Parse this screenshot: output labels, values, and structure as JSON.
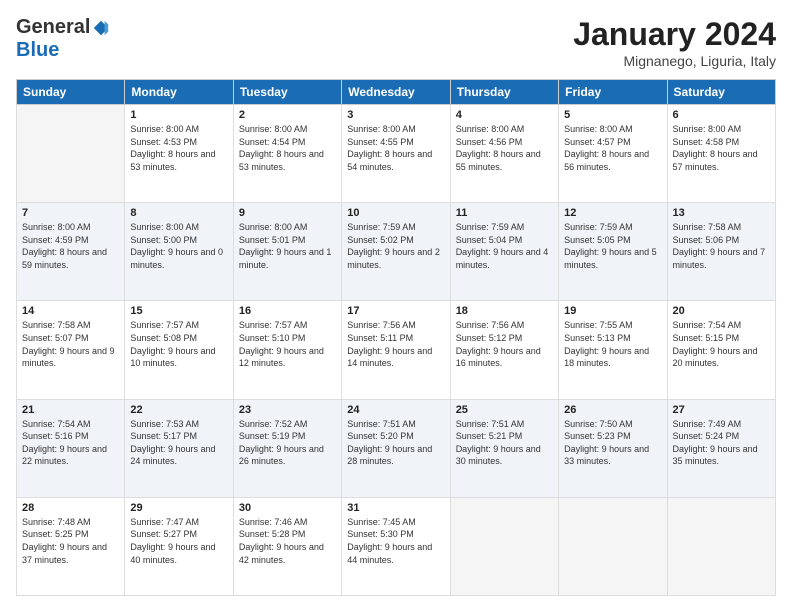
{
  "header": {
    "logo_general": "General",
    "logo_blue": "Blue",
    "month_title": "January 2024",
    "location": "Mignanego, Liguria, Italy"
  },
  "days_of_week": [
    "Sunday",
    "Monday",
    "Tuesday",
    "Wednesday",
    "Thursday",
    "Friday",
    "Saturday"
  ],
  "weeks": [
    [
      {
        "day": "",
        "sunrise": "",
        "sunset": "",
        "daylight": "",
        "empty": true
      },
      {
        "day": "1",
        "sunrise": "Sunrise: 8:00 AM",
        "sunset": "Sunset: 4:53 PM",
        "daylight": "Daylight: 8 hours and 53 minutes."
      },
      {
        "day": "2",
        "sunrise": "Sunrise: 8:00 AM",
        "sunset": "Sunset: 4:54 PM",
        "daylight": "Daylight: 8 hours and 53 minutes."
      },
      {
        "day": "3",
        "sunrise": "Sunrise: 8:00 AM",
        "sunset": "Sunset: 4:55 PM",
        "daylight": "Daylight: 8 hours and 54 minutes."
      },
      {
        "day": "4",
        "sunrise": "Sunrise: 8:00 AM",
        "sunset": "Sunset: 4:56 PM",
        "daylight": "Daylight: 8 hours and 55 minutes."
      },
      {
        "day": "5",
        "sunrise": "Sunrise: 8:00 AM",
        "sunset": "Sunset: 4:57 PM",
        "daylight": "Daylight: 8 hours and 56 minutes."
      },
      {
        "day": "6",
        "sunrise": "Sunrise: 8:00 AM",
        "sunset": "Sunset: 4:58 PM",
        "daylight": "Daylight: 8 hours and 57 minutes."
      }
    ],
    [
      {
        "day": "7",
        "sunrise": "Sunrise: 8:00 AM",
        "sunset": "Sunset: 4:59 PM",
        "daylight": "Daylight: 8 hours and 59 minutes."
      },
      {
        "day": "8",
        "sunrise": "Sunrise: 8:00 AM",
        "sunset": "Sunset: 5:00 PM",
        "daylight": "Daylight: 9 hours and 0 minutes."
      },
      {
        "day": "9",
        "sunrise": "Sunrise: 8:00 AM",
        "sunset": "Sunset: 5:01 PM",
        "daylight": "Daylight: 9 hours and 1 minute."
      },
      {
        "day": "10",
        "sunrise": "Sunrise: 7:59 AM",
        "sunset": "Sunset: 5:02 PM",
        "daylight": "Daylight: 9 hours and 2 minutes."
      },
      {
        "day": "11",
        "sunrise": "Sunrise: 7:59 AM",
        "sunset": "Sunset: 5:04 PM",
        "daylight": "Daylight: 9 hours and 4 minutes."
      },
      {
        "day": "12",
        "sunrise": "Sunrise: 7:59 AM",
        "sunset": "Sunset: 5:05 PM",
        "daylight": "Daylight: 9 hours and 5 minutes."
      },
      {
        "day": "13",
        "sunrise": "Sunrise: 7:58 AM",
        "sunset": "Sunset: 5:06 PM",
        "daylight": "Daylight: 9 hours and 7 minutes."
      }
    ],
    [
      {
        "day": "14",
        "sunrise": "Sunrise: 7:58 AM",
        "sunset": "Sunset: 5:07 PM",
        "daylight": "Daylight: 9 hours and 9 minutes."
      },
      {
        "day": "15",
        "sunrise": "Sunrise: 7:57 AM",
        "sunset": "Sunset: 5:08 PM",
        "daylight": "Daylight: 9 hours and 10 minutes."
      },
      {
        "day": "16",
        "sunrise": "Sunrise: 7:57 AM",
        "sunset": "Sunset: 5:10 PM",
        "daylight": "Daylight: 9 hours and 12 minutes."
      },
      {
        "day": "17",
        "sunrise": "Sunrise: 7:56 AM",
        "sunset": "Sunset: 5:11 PM",
        "daylight": "Daylight: 9 hours and 14 minutes."
      },
      {
        "day": "18",
        "sunrise": "Sunrise: 7:56 AM",
        "sunset": "Sunset: 5:12 PM",
        "daylight": "Daylight: 9 hours and 16 minutes."
      },
      {
        "day": "19",
        "sunrise": "Sunrise: 7:55 AM",
        "sunset": "Sunset: 5:13 PM",
        "daylight": "Daylight: 9 hours and 18 minutes."
      },
      {
        "day": "20",
        "sunrise": "Sunrise: 7:54 AM",
        "sunset": "Sunset: 5:15 PM",
        "daylight": "Daylight: 9 hours and 20 minutes."
      }
    ],
    [
      {
        "day": "21",
        "sunrise": "Sunrise: 7:54 AM",
        "sunset": "Sunset: 5:16 PM",
        "daylight": "Daylight: 9 hours and 22 minutes."
      },
      {
        "day": "22",
        "sunrise": "Sunrise: 7:53 AM",
        "sunset": "Sunset: 5:17 PM",
        "daylight": "Daylight: 9 hours and 24 minutes."
      },
      {
        "day": "23",
        "sunrise": "Sunrise: 7:52 AM",
        "sunset": "Sunset: 5:19 PM",
        "daylight": "Daylight: 9 hours and 26 minutes."
      },
      {
        "day": "24",
        "sunrise": "Sunrise: 7:51 AM",
        "sunset": "Sunset: 5:20 PM",
        "daylight": "Daylight: 9 hours and 28 minutes."
      },
      {
        "day": "25",
        "sunrise": "Sunrise: 7:51 AM",
        "sunset": "Sunset: 5:21 PM",
        "daylight": "Daylight: 9 hours and 30 minutes."
      },
      {
        "day": "26",
        "sunrise": "Sunrise: 7:50 AM",
        "sunset": "Sunset: 5:23 PM",
        "daylight": "Daylight: 9 hours and 33 minutes."
      },
      {
        "day": "27",
        "sunrise": "Sunrise: 7:49 AM",
        "sunset": "Sunset: 5:24 PM",
        "daylight": "Daylight: 9 hours and 35 minutes."
      }
    ],
    [
      {
        "day": "28",
        "sunrise": "Sunrise: 7:48 AM",
        "sunset": "Sunset: 5:25 PM",
        "daylight": "Daylight: 9 hours and 37 minutes."
      },
      {
        "day": "29",
        "sunrise": "Sunrise: 7:47 AM",
        "sunset": "Sunset: 5:27 PM",
        "daylight": "Daylight: 9 hours and 40 minutes."
      },
      {
        "day": "30",
        "sunrise": "Sunrise: 7:46 AM",
        "sunset": "Sunset: 5:28 PM",
        "daylight": "Daylight: 9 hours and 42 minutes."
      },
      {
        "day": "31",
        "sunrise": "Sunrise: 7:45 AM",
        "sunset": "Sunset: 5:30 PM",
        "daylight": "Daylight: 9 hours and 44 minutes."
      },
      {
        "day": "",
        "sunrise": "",
        "sunset": "",
        "daylight": "",
        "empty": true
      },
      {
        "day": "",
        "sunrise": "",
        "sunset": "",
        "daylight": "",
        "empty": true
      },
      {
        "day": "",
        "sunrise": "",
        "sunset": "",
        "daylight": "",
        "empty": true
      }
    ]
  ]
}
